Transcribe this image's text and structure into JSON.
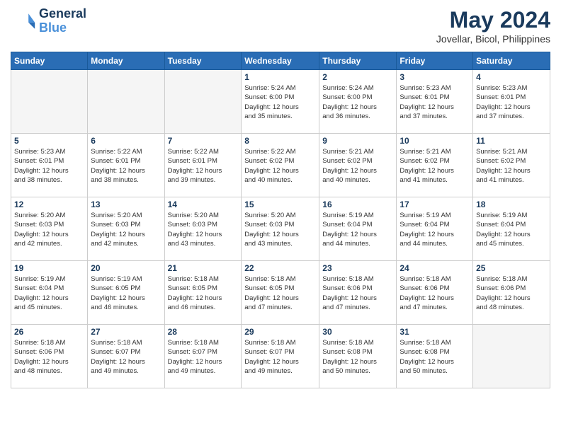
{
  "header": {
    "logo_line1": "General",
    "logo_line2": "Blue",
    "month_year": "May 2024",
    "location": "Jovellar, Bicol, Philippines"
  },
  "weekdays": [
    "Sunday",
    "Monday",
    "Tuesday",
    "Wednesday",
    "Thursday",
    "Friday",
    "Saturday"
  ],
  "weeks": [
    [
      {
        "day": "",
        "info": "",
        "empty": true
      },
      {
        "day": "",
        "info": "",
        "empty": true
      },
      {
        "day": "",
        "info": "",
        "empty": true
      },
      {
        "day": "1",
        "info": "Sunrise: 5:24 AM\nSunset: 6:00 PM\nDaylight: 12 hours\nand 35 minutes."
      },
      {
        "day": "2",
        "info": "Sunrise: 5:24 AM\nSunset: 6:00 PM\nDaylight: 12 hours\nand 36 minutes."
      },
      {
        "day": "3",
        "info": "Sunrise: 5:23 AM\nSunset: 6:01 PM\nDaylight: 12 hours\nand 37 minutes."
      },
      {
        "day": "4",
        "info": "Sunrise: 5:23 AM\nSunset: 6:01 PM\nDaylight: 12 hours\nand 37 minutes."
      }
    ],
    [
      {
        "day": "5",
        "info": "Sunrise: 5:23 AM\nSunset: 6:01 PM\nDaylight: 12 hours\nand 38 minutes."
      },
      {
        "day": "6",
        "info": "Sunrise: 5:22 AM\nSunset: 6:01 PM\nDaylight: 12 hours\nand 38 minutes."
      },
      {
        "day": "7",
        "info": "Sunrise: 5:22 AM\nSunset: 6:01 PM\nDaylight: 12 hours\nand 39 minutes."
      },
      {
        "day": "8",
        "info": "Sunrise: 5:22 AM\nSunset: 6:02 PM\nDaylight: 12 hours\nand 40 minutes."
      },
      {
        "day": "9",
        "info": "Sunrise: 5:21 AM\nSunset: 6:02 PM\nDaylight: 12 hours\nand 40 minutes."
      },
      {
        "day": "10",
        "info": "Sunrise: 5:21 AM\nSunset: 6:02 PM\nDaylight: 12 hours\nand 41 minutes."
      },
      {
        "day": "11",
        "info": "Sunrise: 5:21 AM\nSunset: 6:02 PM\nDaylight: 12 hours\nand 41 minutes."
      }
    ],
    [
      {
        "day": "12",
        "info": "Sunrise: 5:20 AM\nSunset: 6:03 PM\nDaylight: 12 hours\nand 42 minutes."
      },
      {
        "day": "13",
        "info": "Sunrise: 5:20 AM\nSunset: 6:03 PM\nDaylight: 12 hours\nand 42 minutes."
      },
      {
        "day": "14",
        "info": "Sunrise: 5:20 AM\nSunset: 6:03 PM\nDaylight: 12 hours\nand 43 minutes."
      },
      {
        "day": "15",
        "info": "Sunrise: 5:20 AM\nSunset: 6:03 PM\nDaylight: 12 hours\nand 43 minutes."
      },
      {
        "day": "16",
        "info": "Sunrise: 5:19 AM\nSunset: 6:04 PM\nDaylight: 12 hours\nand 44 minutes."
      },
      {
        "day": "17",
        "info": "Sunrise: 5:19 AM\nSunset: 6:04 PM\nDaylight: 12 hours\nand 44 minutes."
      },
      {
        "day": "18",
        "info": "Sunrise: 5:19 AM\nSunset: 6:04 PM\nDaylight: 12 hours\nand 45 minutes."
      }
    ],
    [
      {
        "day": "19",
        "info": "Sunrise: 5:19 AM\nSunset: 6:04 PM\nDaylight: 12 hours\nand 45 minutes."
      },
      {
        "day": "20",
        "info": "Sunrise: 5:19 AM\nSunset: 6:05 PM\nDaylight: 12 hours\nand 46 minutes."
      },
      {
        "day": "21",
        "info": "Sunrise: 5:18 AM\nSunset: 6:05 PM\nDaylight: 12 hours\nand 46 minutes."
      },
      {
        "day": "22",
        "info": "Sunrise: 5:18 AM\nSunset: 6:05 PM\nDaylight: 12 hours\nand 47 minutes."
      },
      {
        "day": "23",
        "info": "Sunrise: 5:18 AM\nSunset: 6:06 PM\nDaylight: 12 hours\nand 47 minutes."
      },
      {
        "day": "24",
        "info": "Sunrise: 5:18 AM\nSunset: 6:06 PM\nDaylight: 12 hours\nand 47 minutes."
      },
      {
        "day": "25",
        "info": "Sunrise: 5:18 AM\nSunset: 6:06 PM\nDaylight: 12 hours\nand 48 minutes."
      }
    ],
    [
      {
        "day": "26",
        "info": "Sunrise: 5:18 AM\nSunset: 6:06 PM\nDaylight: 12 hours\nand 48 minutes."
      },
      {
        "day": "27",
        "info": "Sunrise: 5:18 AM\nSunset: 6:07 PM\nDaylight: 12 hours\nand 49 minutes."
      },
      {
        "day": "28",
        "info": "Sunrise: 5:18 AM\nSunset: 6:07 PM\nDaylight: 12 hours\nand 49 minutes."
      },
      {
        "day": "29",
        "info": "Sunrise: 5:18 AM\nSunset: 6:07 PM\nDaylight: 12 hours\nand 49 minutes."
      },
      {
        "day": "30",
        "info": "Sunrise: 5:18 AM\nSunset: 6:08 PM\nDaylight: 12 hours\nand 50 minutes."
      },
      {
        "day": "31",
        "info": "Sunrise: 5:18 AM\nSunset: 6:08 PM\nDaylight: 12 hours\nand 50 minutes."
      },
      {
        "day": "",
        "info": "",
        "empty": true
      }
    ]
  ]
}
